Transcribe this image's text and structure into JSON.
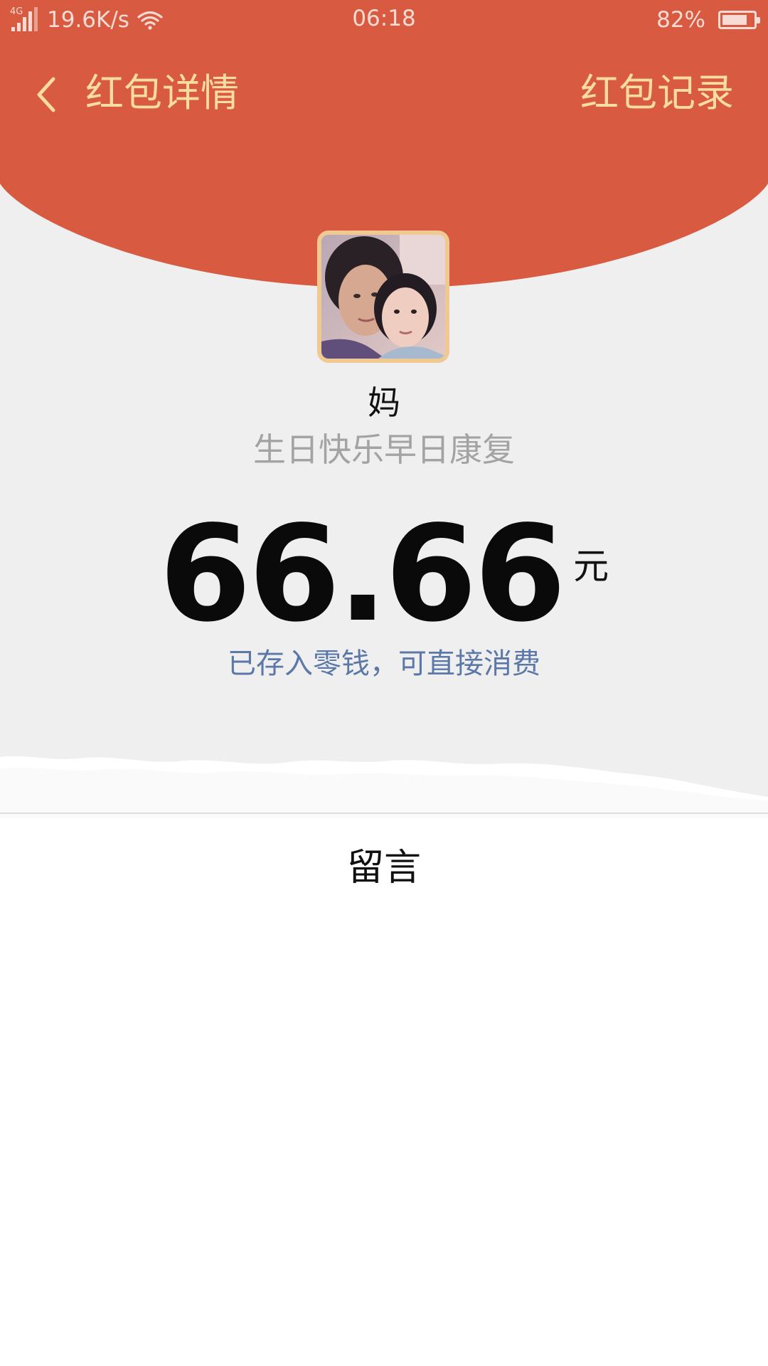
{
  "status_bar": {
    "network_type": "4G",
    "net_speed": "19.6K/s",
    "time": "06:18",
    "battery_percent": "82%",
    "battery_level": 0.82
  },
  "nav": {
    "title": "红包详情",
    "record_link": "红包记录",
    "back_icon": "chevron-left-icon"
  },
  "packet": {
    "sender": "妈",
    "greeting": "生日快乐早日康复",
    "amount": "66.66",
    "unit": "元",
    "wallet_note": "已存入零钱，可直接消费"
  },
  "message": {
    "label": "留言"
  },
  "colors": {
    "header_red": "#d85a40",
    "gold_text": "#f8dca0",
    "avatar_border": "#efc991",
    "link_blue": "#5b78a8",
    "panel_gray": "#efefef"
  }
}
